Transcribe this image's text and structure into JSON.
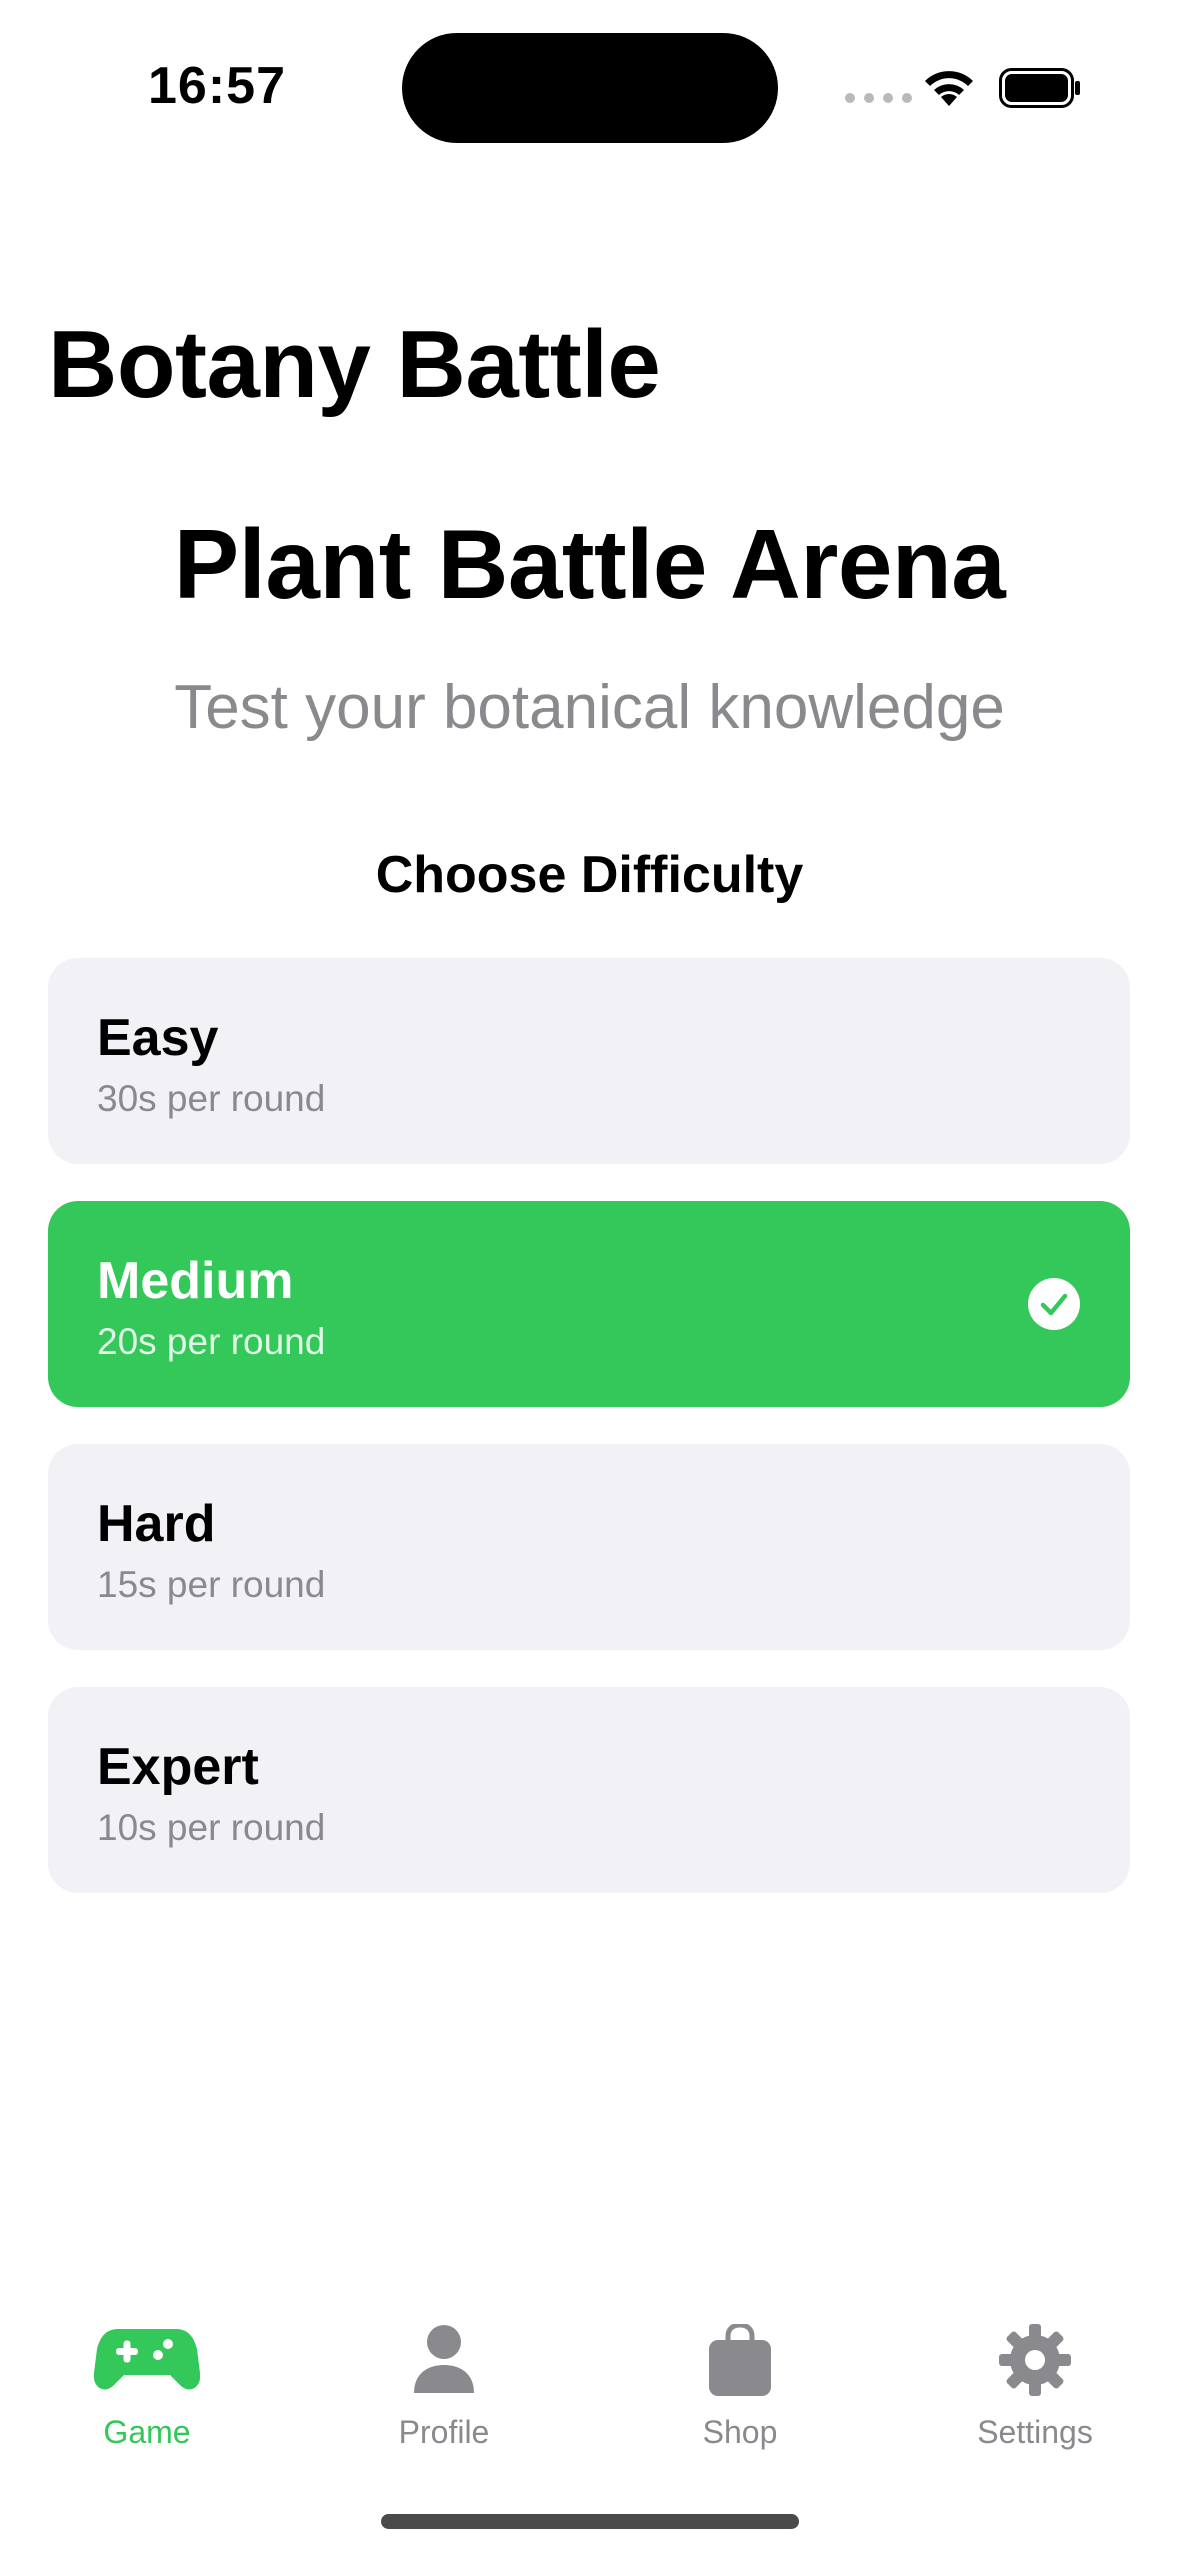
{
  "status_bar": {
    "time": "16:57"
  },
  "nav": {
    "title": "Botany Battle"
  },
  "hero": {
    "title": "Plant Battle Arena",
    "subtitle": "Test your botanical knowledge"
  },
  "difficulty": {
    "heading": "Choose Difficulty",
    "selected": "Medium",
    "options": [
      {
        "label": "Easy",
        "detail": "30s per round"
      },
      {
        "label": "Medium",
        "detail": "20s per round"
      },
      {
        "label": "Hard",
        "detail": "15s per round"
      },
      {
        "label": "Expert",
        "detail": "10s per round"
      }
    ]
  },
  "tab_bar": {
    "active": "Game",
    "tabs": [
      {
        "label": "Game",
        "icon": "gamecontroller-icon"
      },
      {
        "label": "Profile",
        "icon": "person-icon"
      },
      {
        "label": "Shop",
        "icon": "bag-icon"
      },
      {
        "label": "Settings",
        "icon": "gear-icon"
      }
    ]
  },
  "colors": {
    "accent": "#34c759",
    "card_background": "#f1f1f6",
    "secondary_text": "#8a8a8e",
    "tab_inactive": "#8a8a8e"
  }
}
